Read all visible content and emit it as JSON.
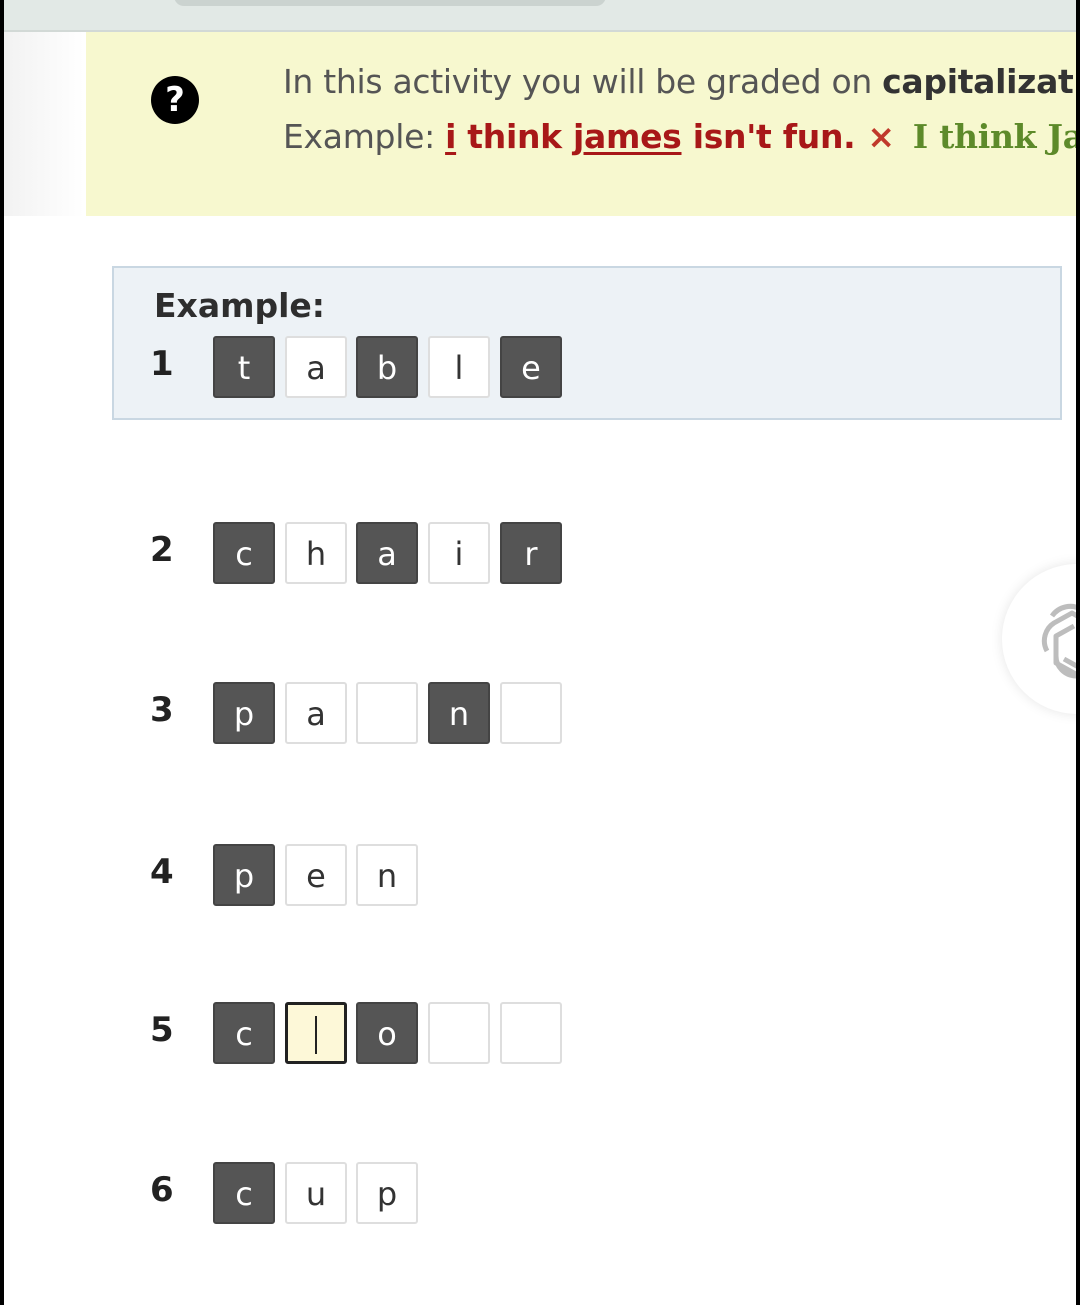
{
  "notice": {
    "line1_prefix": "In this activity you will be graded on ",
    "line1_bold": "capitalization",
    "line2_label": "Example: ",
    "wrong_i": "i",
    "wrong_sp1": " think ",
    "wrong_james": "james",
    "wrong_rest": " isn't fun.",
    "x_mark": "×",
    "correct_text": "I think James isn't fun."
  },
  "example": {
    "title": "Example:"
  },
  "rows": [
    {
      "number": "1",
      "tiles": [
        {
          "letter": "t",
          "style": "dark"
        },
        {
          "letter": "a",
          "style": "light"
        },
        {
          "letter": "b",
          "style": "dark"
        },
        {
          "letter": "l",
          "style": "light"
        },
        {
          "letter": "e",
          "style": "dark"
        }
      ]
    },
    {
      "number": "2",
      "tiles": [
        {
          "letter": "c",
          "style": "dark"
        },
        {
          "letter": "h",
          "style": "light"
        },
        {
          "letter": "a",
          "style": "dark"
        },
        {
          "letter": "i",
          "style": "light"
        },
        {
          "letter": "r",
          "style": "dark"
        }
      ]
    },
    {
      "number": "3",
      "tiles": [
        {
          "letter": "p",
          "style": "dark"
        },
        {
          "letter": "a",
          "style": "light"
        },
        {
          "letter": "",
          "style": "light"
        },
        {
          "letter": "n",
          "style": "dark"
        },
        {
          "letter": "",
          "style": "light"
        }
      ]
    },
    {
      "number": "4",
      "tiles": [
        {
          "letter": "p",
          "style": "dark"
        },
        {
          "letter": "e",
          "style": "light"
        },
        {
          "letter": "n",
          "style": "light"
        }
      ]
    },
    {
      "number": "5",
      "tiles": [
        {
          "letter": "c",
          "style": "dark"
        },
        {
          "letter": "",
          "style": "active"
        },
        {
          "letter": "o",
          "style": "dark"
        },
        {
          "letter": "",
          "style": "light"
        },
        {
          "letter": "",
          "style": "light"
        }
      ]
    },
    {
      "number": "6",
      "tiles": [
        {
          "letter": "c",
          "style": "dark"
        },
        {
          "letter": "u",
          "style": "light"
        },
        {
          "letter": "p",
          "style": "light"
        }
      ]
    }
  ],
  "icons": {
    "help": "question-circle-icon",
    "floating": "openai-knot-icon"
  }
}
